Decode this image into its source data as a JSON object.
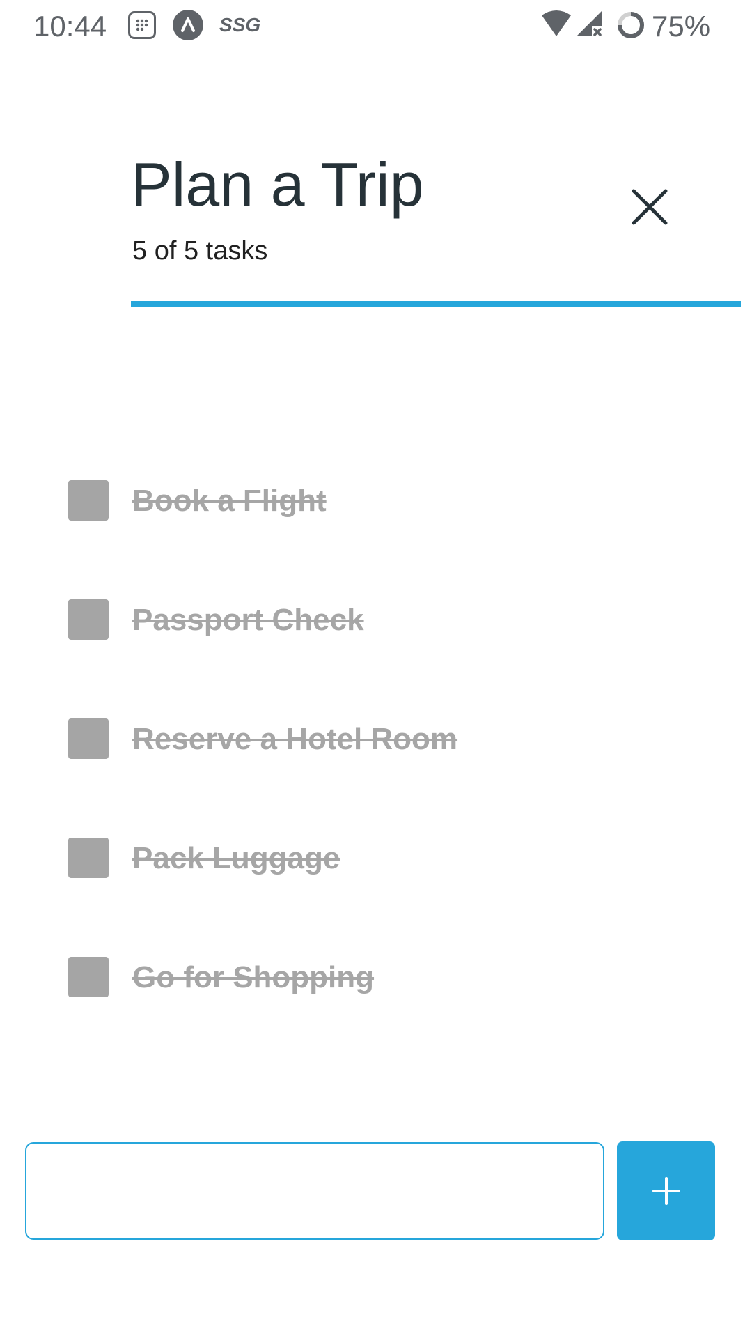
{
  "status_bar": {
    "time": "10:44",
    "indicator_text": "SSG",
    "battery": "75%",
    "icons": [
      "calendar-icon",
      "a-circle-icon",
      "wifi-icon",
      "signal-icon",
      "battery-icon"
    ]
  },
  "header": {
    "title": "Plan a Trip",
    "task_count": "5 of 5 tasks",
    "progress_fraction": 1.0
  },
  "tasks": [
    {
      "label": "Book a Flight",
      "done": true
    },
    {
      "label": "Passport Check",
      "done": true
    },
    {
      "label": "Reserve a Hotel Room",
      "done": true
    },
    {
      "label": "Pack Luggage",
      "done": true
    },
    {
      "label": "Go for Shopping",
      "done": true
    }
  ],
  "new_task": {
    "value": "",
    "placeholder": ""
  },
  "colors": {
    "accent": "#26a6db",
    "title_text": "#263238",
    "completed_text": "#a6a6a6",
    "checkbox_fill": "#a5a5a5"
  }
}
